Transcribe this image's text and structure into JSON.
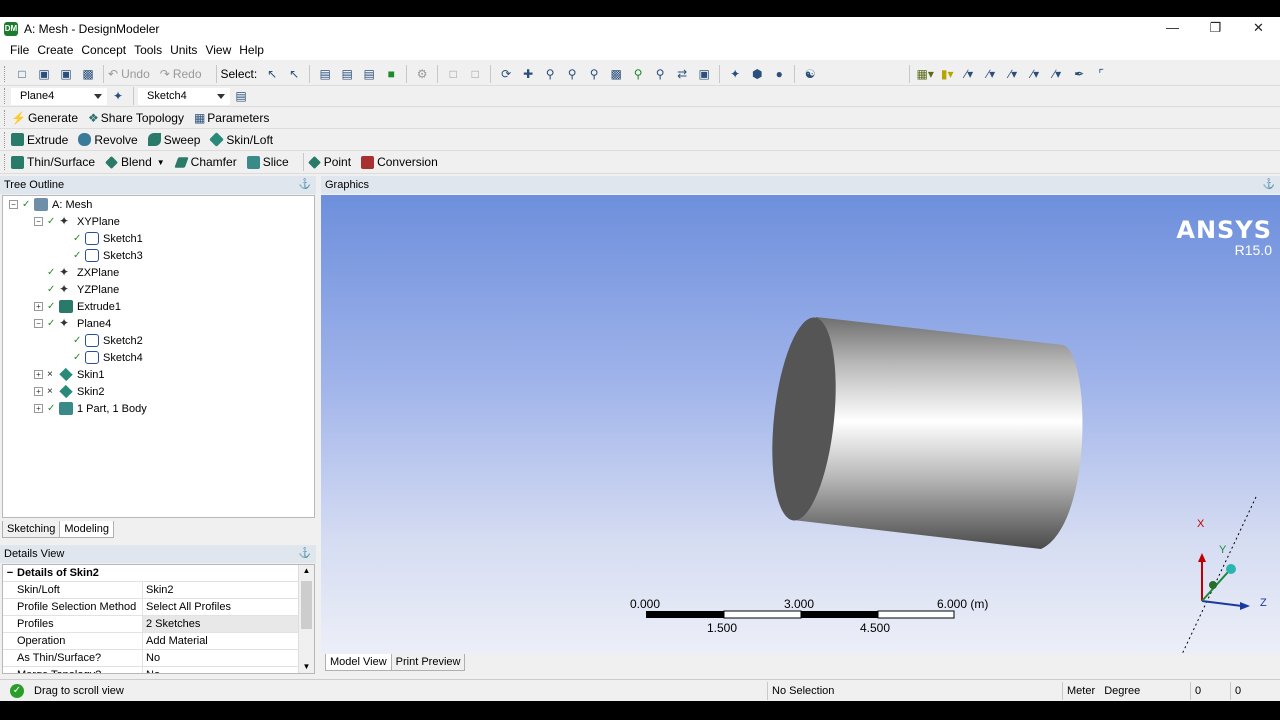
{
  "window": {
    "title": "A: Mesh - DesignModeler",
    "icon_text": "DM",
    "controls": [
      "—",
      "❐",
      "✕"
    ]
  },
  "menu": [
    "File",
    "Create",
    "Concept",
    "Tools",
    "Units",
    "View",
    "Help"
  ],
  "toolbar1": {
    "undo_label": "Undo",
    "redo_label": "Redo",
    "select_label": "Select:"
  },
  "toolbar2": {
    "plane_value": "Plane4",
    "sketch_value": "Sketch4"
  },
  "toolbar3": {
    "generate": "Generate",
    "share_topology": "Share Topology",
    "parameters": "Parameters"
  },
  "toolbar4": {
    "extrude": "Extrude",
    "revolve": "Revolve",
    "sweep": "Sweep",
    "skin_loft": "Skin/Loft"
  },
  "toolbar5": {
    "thin_surface": "Thin/Surface",
    "blend": "Blend",
    "chamfer": "Chamfer",
    "slice": "Slice",
    "point": "Point",
    "conversion": "Conversion"
  },
  "tree_outline": {
    "title": "Tree Outline",
    "items": [
      {
        "label": "A: Mesh"
      },
      {
        "label": "XYPlane"
      },
      {
        "label": "Sketch1"
      },
      {
        "label": "Sketch3"
      },
      {
        "label": "ZXPlane"
      },
      {
        "label": "YZPlane"
      },
      {
        "label": "Extrude1"
      },
      {
        "label": "Plane4"
      },
      {
        "label": "Sketch2"
      },
      {
        "label": "Sketch4"
      },
      {
        "label": "Skin1"
      },
      {
        "label": "Skin2"
      },
      {
        "label": "1 Part, 1 Body"
      }
    ],
    "tabs": [
      "Sketching",
      "Modeling"
    ]
  },
  "details_view": {
    "title": "Details View",
    "group": "Details of Skin2",
    "rows": [
      {
        "key": "Skin/Loft",
        "value": "Skin2"
      },
      {
        "key": "Profile Selection Method",
        "value": "Select All Profiles"
      },
      {
        "key": "Profiles",
        "value": "2 Sketches"
      },
      {
        "key": "Operation",
        "value": "Add Material"
      },
      {
        "key": "As Thin/Surface?",
        "value": "No"
      },
      {
        "key": "Merge Topology?",
        "value": "No"
      }
    ]
  },
  "graphics": {
    "title": "Graphics",
    "brand": "ANSYS",
    "version": "R15.0",
    "scale_top": [
      "0.000",
      "3.000",
      "6.000 (m)"
    ],
    "scale_bottom": [
      "1.500",
      "4.500"
    ],
    "axes": [
      "X",
      "Y",
      "Z"
    ],
    "tabs": [
      "Model View",
      "Print Preview"
    ]
  },
  "status": {
    "message": "Drag to scroll view",
    "selection": "No Selection",
    "length_unit": "Meter",
    "angle_unit": "Degree",
    "value1": "0",
    "value2": "0"
  },
  "colors": {
    "graphics_top": "#6d8fdc",
    "graphics_bottom": "#eceff8",
    "ok_green": "#2a9d2a"
  }
}
